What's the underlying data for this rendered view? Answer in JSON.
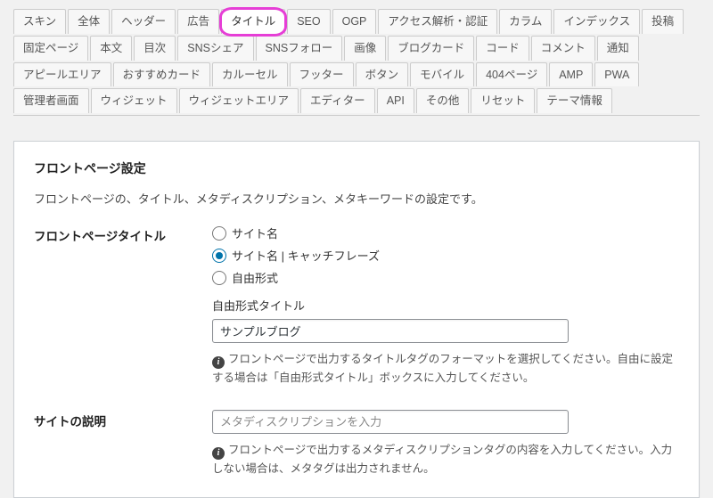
{
  "tabs": {
    "row1": [
      "スキン",
      "全体",
      "ヘッダー",
      "広告",
      "タイトル",
      "SEO",
      "OGP",
      "アクセス解析・認証",
      "カラム",
      "インデックス",
      "投稿"
    ],
    "row2": [
      "固定ページ",
      "本文",
      "目次",
      "SNSシェア",
      "SNSフォロー",
      "画像",
      "ブログカード",
      "コード",
      "コメント",
      "通知",
      "アピールエリア"
    ],
    "row3": [
      "おすすめカード",
      "カルーセル",
      "フッター",
      "ボタン",
      "モバイル",
      "404ページ",
      "AMP",
      "PWA",
      "管理者画面",
      "ウィジェット"
    ],
    "row4": [
      "ウィジェットエリア",
      "エディター",
      "API",
      "その他",
      "リセット",
      "テーマ情報"
    ],
    "highlighted": "タイトル",
    "active": "タイトル"
  },
  "panel": {
    "heading": "フロントページ設定",
    "description": "フロントページの、タイトル、メタディスクリプション、メタキーワードの設定です。",
    "section_title_heading": "フロントページタイトル",
    "radios": {
      "opt1": "サイト名",
      "opt2": "サイト名 | キャッチフレーズ",
      "opt3": "自由形式",
      "checked": "opt2"
    },
    "freeform_label": "自由形式タイトル",
    "freeform_value": "サンプルブログ",
    "freeform_help": "フロントページで出力するタイトルタグのフォーマットを選択してください。自由に設定する場合は「自由形式タイトル」ボックスに入力してください。",
    "site_desc_label": "サイトの説明",
    "site_desc_placeholder": "メタディスクリプションを入力",
    "site_desc_help": "フロントページで出力するメタディスクリプションタグの内容を入力してください。入力しない場合は、メタタグは出力されません。"
  },
  "icons": {
    "info": "i"
  }
}
